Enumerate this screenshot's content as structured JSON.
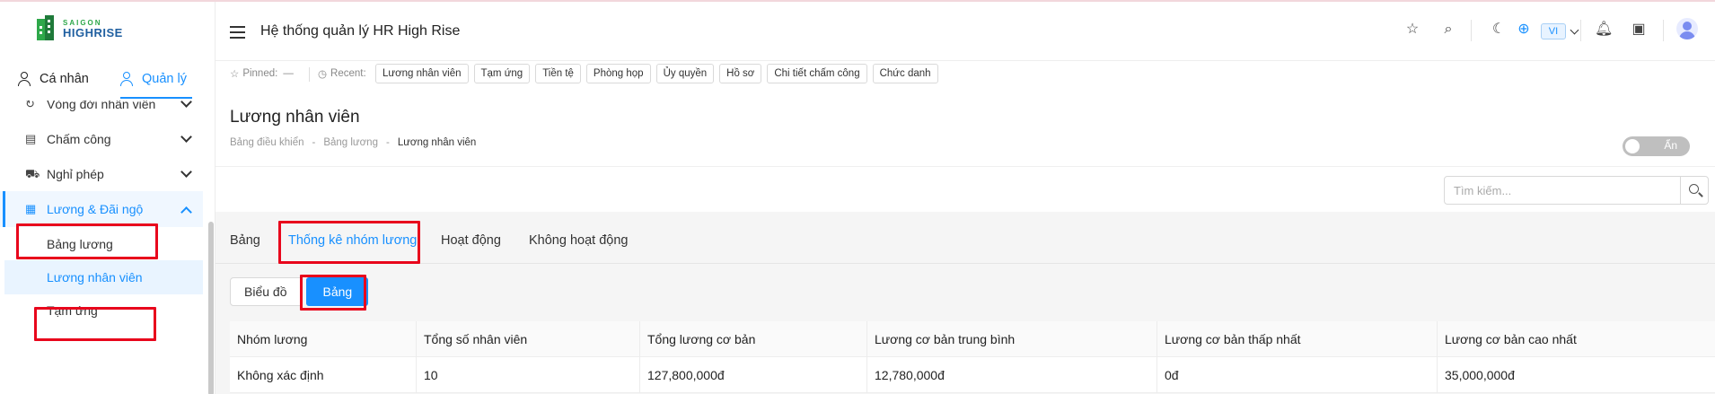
{
  "logo": {
    "line1": "SAIGON",
    "line2": "HIGHRISE"
  },
  "mode_tabs": {
    "personal": "Cá nhân",
    "manage": "Quản lý"
  },
  "menu": {
    "items": [
      {
        "label": "Vòng đời nhân viên",
        "icon": "loop-icon"
      },
      {
        "label": "Chấm công",
        "icon": "timesheet-icon"
      },
      {
        "label": "Nghỉ phép",
        "icon": "car-icon"
      },
      {
        "label": "Lương & Đãi ngộ",
        "icon": "payroll-icon"
      }
    ],
    "sub_items": [
      {
        "label": "Bảng lương"
      },
      {
        "label": "Lương nhân viên"
      },
      {
        "label": "Tạm ứng"
      }
    ]
  },
  "header": {
    "title": "Hệ thống quản lý HR High Rise",
    "language": "VI",
    "icons": [
      "star-icon",
      "search-icon",
      "moon-icon",
      "plus-circle-icon",
      "bell-icon",
      "calendar-icon",
      "avatar"
    ]
  },
  "recent_bar": {
    "pinned_label": "Pinned:",
    "pinned_value": "—",
    "recent_label": "Recent:",
    "chips": [
      "Lương nhân viên",
      "Tạm ứng",
      "Tiền tệ",
      "Phòng họp",
      "Ủy quyền",
      "Hồ sơ",
      "Chi tiết chấm công",
      "Chức danh"
    ]
  },
  "page": {
    "title": "Lương nhân viên",
    "breadcrumb": [
      "Bảng điều khiển",
      "Bảng lương",
      "Lương nhân viên"
    ],
    "toggle_label": "Ẩn",
    "toggle_on": false,
    "search_placeholder": "Tìm kiếm..."
  },
  "tabs": [
    "Bảng",
    "Thống kê nhóm lương",
    "Hoạt động",
    "Không hoạt động"
  ],
  "active_tab": "Thống kê nhóm lương",
  "view_buttons": {
    "chart": "Biểu đồ",
    "table": "Bảng"
  },
  "table": {
    "columns": [
      "Nhóm lương",
      "Tổng số nhân viên",
      "Tổng lương cơ bản",
      "Lương cơ bản trung bình",
      "Lương cơ bản thấp nhất",
      "Lương cơ bản cao nhất"
    ],
    "rows": [
      [
        "Không xác định",
        "10",
        "127,800,000đ",
        "12,780,000đ",
        "0đ",
        "35,000,000đ"
      ]
    ]
  },
  "colors": {
    "accent": "#1890ff",
    "highlight": "#e8061c",
    "brand_green": "#2ea84a"
  }
}
